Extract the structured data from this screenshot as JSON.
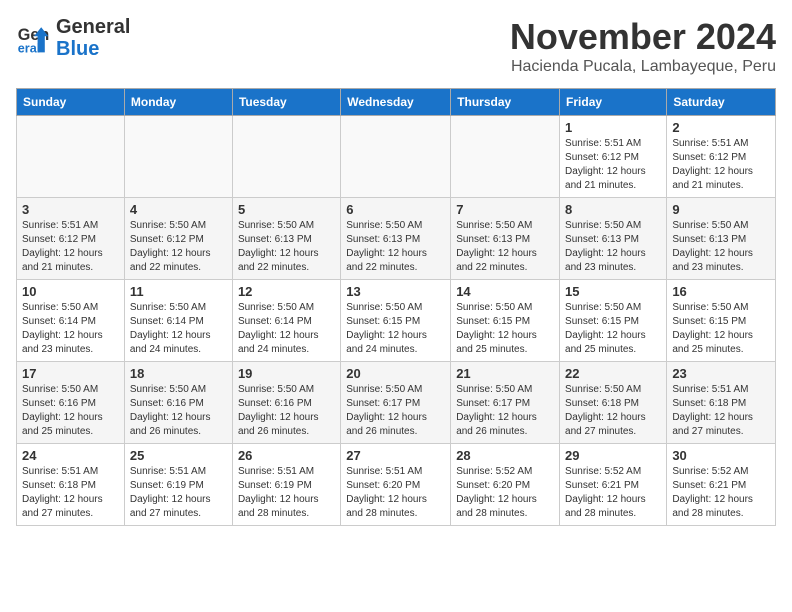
{
  "logo": {
    "line1": "General",
    "line2": "Blue"
  },
  "title": "November 2024",
  "location": "Hacienda Pucala, Lambayeque, Peru",
  "weekdays": [
    "Sunday",
    "Monday",
    "Tuesday",
    "Wednesday",
    "Thursday",
    "Friday",
    "Saturday"
  ],
  "weeks": [
    [
      {
        "day": "",
        "info": ""
      },
      {
        "day": "",
        "info": ""
      },
      {
        "day": "",
        "info": ""
      },
      {
        "day": "",
        "info": ""
      },
      {
        "day": "",
        "info": ""
      },
      {
        "day": "1",
        "info": "Sunrise: 5:51 AM\nSunset: 6:12 PM\nDaylight: 12 hours and 21 minutes."
      },
      {
        "day": "2",
        "info": "Sunrise: 5:51 AM\nSunset: 6:12 PM\nDaylight: 12 hours and 21 minutes."
      }
    ],
    [
      {
        "day": "3",
        "info": "Sunrise: 5:51 AM\nSunset: 6:12 PM\nDaylight: 12 hours and 21 minutes."
      },
      {
        "day": "4",
        "info": "Sunrise: 5:50 AM\nSunset: 6:12 PM\nDaylight: 12 hours and 22 minutes."
      },
      {
        "day": "5",
        "info": "Sunrise: 5:50 AM\nSunset: 6:13 PM\nDaylight: 12 hours and 22 minutes."
      },
      {
        "day": "6",
        "info": "Sunrise: 5:50 AM\nSunset: 6:13 PM\nDaylight: 12 hours and 22 minutes."
      },
      {
        "day": "7",
        "info": "Sunrise: 5:50 AM\nSunset: 6:13 PM\nDaylight: 12 hours and 22 minutes."
      },
      {
        "day": "8",
        "info": "Sunrise: 5:50 AM\nSunset: 6:13 PM\nDaylight: 12 hours and 23 minutes."
      },
      {
        "day": "9",
        "info": "Sunrise: 5:50 AM\nSunset: 6:13 PM\nDaylight: 12 hours and 23 minutes."
      }
    ],
    [
      {
        "day": "10",
        "info": "Sunrise: 5:50 AM\nSunset: 6:14 PM\nDaylight: 12 hours and 23 minutes."
      },
      {
        "day": "11",
        "info": "Sunrise: 5:50 AM\nSunset: 6:14 PM\nDaylight: 12 hours and 24 minutes."
      },
      {
        "day": "12",
        "info": "Sunrise: 5:50 AM\nSunset: 6:14 PM\nDaylight: 12 hours and 24 minutes."
      },
      {
        "day": "13",
        "info": "Sunrise: 5:50 AM\nSunset: 6:15 PM\nDaylight: 12 hours and 24 minutes."
      },
      {
        "day": "14",
        "info": "Sunrise: 5:50 AM\nSunset: 6:15 PM\nDaylight: 12 hours and 25 minutes."
      },
      {
        "day": "15",
        "info": "Sunrise: 5:50 AM\nSunset: 6:15 PM\nDaylight: 12 hours and 25 minutes."
      },
      {
        "day": "16",
        "info": "Sunrise: 5:50 AM\nSunset: 6:15 PM\nDaylight: 12 hours and 25 minutes."
      }
    ],
    [
      {
        "day": "17",
        "info": "Sunrise: 5:50 AM\nSunset: 6:16 PM\nDaylight: 12 hours and 25 minutes."
      },
      {
        "day": "18",
        "info": "Sunrise: 5:50 AM\nSunset: 6:16 PM\nDaylight: 12 hours and 26 minutes."
      },
      {
        "day": "19",
        "info": "Sunrise: 5:50 AM\nSunset: 6:16 PM\nDaylight: 12 hours and 26 minutes."
      },
      {
        "day": "20",
        "info": "Sunrise: 5:50 AM\nSunset: 6:17 PM\nDaylight: 12 hours and 26 minutes."
      },
      {
        "day": "21",
        "info": "Sunrise: 5:50 AM\nSunset: 6:17 PM\nDaylight: 12 hours and 26 minutes."
      },
      {
        "day": "22",
        "info": "Sunrise: 5:50 AM\nSunset: 6:18 PM\nDaylight: 12 hours and 27 minutes."
      },
      {
        "day": "23",
        "info": "Sunrise: 5:51 AM\nSunset: 6:18 PM\nDaylight: 12 hours and 27 minutes."
      }
    ],
    [
      {
        "day": "24",
        "info": "Sunrise: 5:51 AM\nSunset: 6:18 PM\nDaylight: 12 hours and 27 minutes."
      },
      {
        "day": "25",
        "info": "Sunrise: 5:51 AM\nSunset: 6:19 PM\nDaylight: 12 hours and 27 minutes."
      },
      {
        "day": "26",
        "info": "Sunrise: 5:51 AM\nSunset: 6:19 PM\nDaylight: 12 hours and 28 minutes."
      },
      {
        "day": "27",
        "info": "Sunrise: 5:51 AM\nSunset: 6:20 PM\nDaylight: 12 hours and 28 minutes."
      },
      {
        "day": "28",
        "info": "Sunrise: 5:52 AM\nSunset: 6:20 PM\nDaylight: 12 hours and 28 minutes."
      },
      {
        "day": "29",
        "info": "Sunrise: 5:52 AM\nSunset: 6:21 PM\nDaylight: 12 hours and 28 minutes."
      },
      {
        "day": "30",
        "info": "Sunrise: 5:52 AM\nSunset: 6:21 PM\nDaylight: 12 hours and 28 minutes."
      }
    ]
  ]
}
